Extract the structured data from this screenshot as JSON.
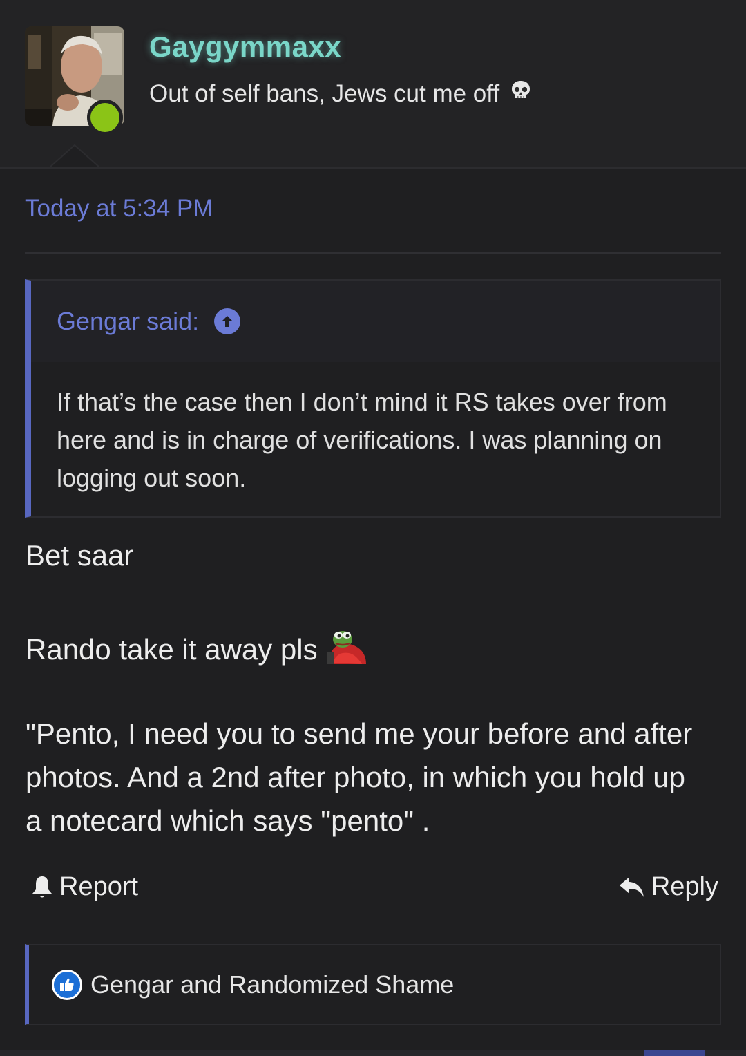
{
  "post": {
    "username": "Gaygymmaxx",
    "user_title": "Out of self bans, Jews cut me off",
    "user_title_emoji": "skull-emoji",
    "timestamp": "Today at 5:34 PM",
    "online_status_color": "#8bc417",
    "quote": {
      "author": "Gengar said:",
      "body": "If that’s the case then I don’t mind it RS takes over from here and is in charge of verifications. I was planning on logging out soon."
    },
    "message": {
      "line1": "Bet saar",
      "line2": "Rando take it away pls",
      "line2_emoji": "pepe-blanket-emoji",
      "line3": "\"Pento, I need you to send me your before and after photos. And a 2nd after photo, in which you hold up a notecard which says \"pento\" ."
    },
    "actions": {
      "report_label": "Report",
      "reply_label": "Reply"
    },
    "reactions": {
      "icon": "thumbs-up-icon",
      "text": "Gengar and Randomized Shame"
    }
  },
  "colors": {
    "background": "#1f1f21",
    "username": "#7ad6c8",
    "link_accent": "#6b7bd6",
    "quote_border": "#5867c0",
    "like_badge": "#1c6fd6"
  }
}
